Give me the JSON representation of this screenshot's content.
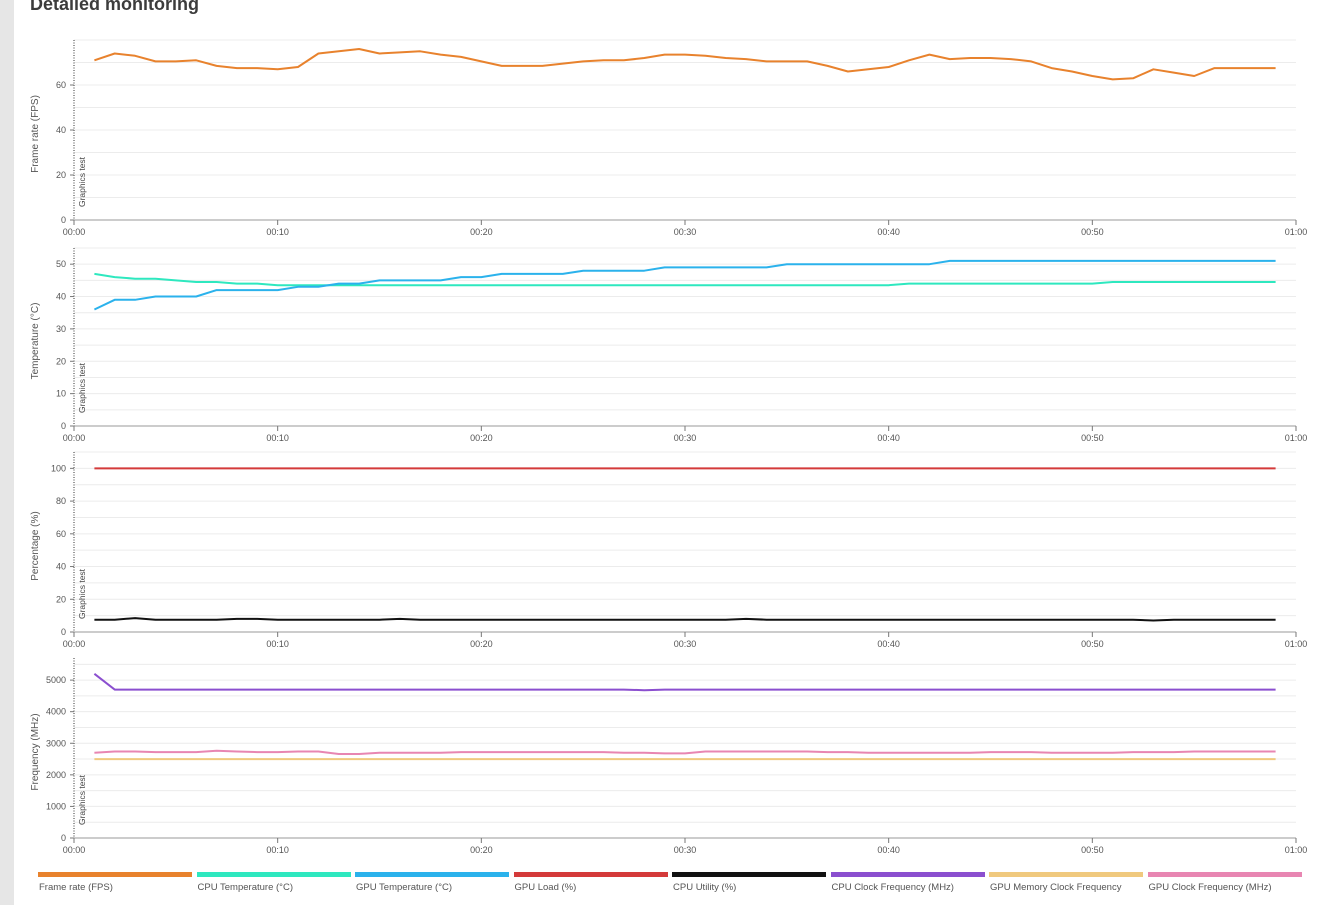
{
  "page": {
    "title": "Detailed monitoring"
  },
  "marker_label": "Graphics test",
  "legend": [
    {
      "label": "Frame rate (FPS)",
      "color": "#e8822d"
    },
    {
      "label": "CPU Temperature (°C)",
      "color": "#2ee8bf"
    },
    {
      "label": "GPU Temperature (°C)",
      "color": "#2bb2ec"
    },
    {
      "label": "GPU Load (%)",
      "color": "#d43a3a"
    },
    {
      "label": "CPU Utility (%)",
      "color": "#111111"
    },
    {
      "label": "CPU Clock Frequency (MHz)",
      "color": "#8b4fcf"
    },
    {
      "label": "GPU Memory Clock Frequency",
      "color": "#f0c97e"
    },
    {
      "label": "GPU Clock Frequency (MHz)",
      "color": "#e886b2"
    }
  ],
  "chart_data": [
    {
      "type": "line",
      "ylabel": "Frame rate (FPS)",
      "ylim": [
        0,
        80
      ],
      "yticks": [
        0,
        20,
        40,
        60
      ],
      "xlim": [
        0,
        60
      ],
      "xticks": [
        "00:00",
        "00:10",
        "00:20",
        "00:30",
        "00:40",
        "00:50",
        "01:00"
      ],
      "grid": true,
      "series": [
        {
          "name": "Frame rate (FPS)",
          "color": "#e8822d",
          "x": [
            1,
            2,
            3,
            4,
            5,
            6,
            7,
            8,
            9,
            10,
            11,
            12,
            13,
            14,
            15,
            16,
            17,
            18,
            19,
            20,
            21,
            22,
            23,
            24,
            25,
            26,
            27,
            28,
            29,
            30,
            31,
            32,
            33,
            34,
            35,
            36,
            37,
            38,
            39,
            40,
            41,
            42,
            43,
            44,
            45,
            46,
            47,
            48,
            49,
            50,
            51,
            52,
            53,
            54,
            55,
            56,
            57,
            58,
            59
          ],
          "y": [
            71,
            74,
            73,
            70.5,
            70.5,
            71,
            68.5,
            67.5,
            67.5,
            67,
            68,
            74,
            75,
            76,
            74,
            74.5,
            75,
            73.5,
            72.5,
            70.5,
            68.5,
            68.5,
            68.5,
            69.5,
            70.5,
            71,
            71,
            72,
            73.5,
            73.5,
            73,
            72,
            71.5,
            70.5,
            70.5,
            70.5,
            68.5,
            66,
            67,
            68,
            71,
            73.5,
            71.5,
            72,
            72,
            71.5,
            70.5,
            67.5,
            66,
            64,
            62.5,
            63,
            67,
            65.5,
            64,
            67.5,
            67.5,
            67.5,
            67.5
          ]
        }
      ]
    },
    {
      "type": "line",
      "ylabel": "Temperature (°C)",
      "ylim": [
        0,
        55
      ],
      "yticks": [
        0,
        10,
        20,
        30,
        40,
        50
      ],
      "xlim": [
        0,
        60
      ],
      "xticks": [
        "00:00",
        "00:10",
        "00:20",
        "00:30",
        "00:40",
        "00:50",
        "01:00"
      ],
      "grid": true,
      "series": [
        {
          "name": "CPU Temperature (°C)",
          "color": "#2ee8bf",
          "x": [
            1,
            2,
            3,
            4,
            5,
            6,
            7,
            8,
            9,
            10,
            11,
            12,
            13,
            14,
            15,
            16,
            17,
            18,
            19,
            20,
            21,
            22,
            23,
            24,
            25,
            26,
            27,
            28,
            29,
            30,
            31,
            32,
            33,
            34,
            35,
            36,
            37,
            38,
            39,
            40,
            41,
            42,
            43,
            44,
            45,
            46,
            47,
            48,
            49,
            50,
            51,
            52,
            53,
            54,
            55,
            56,
            57,
            58,
            59
          ],
          "y": [
            47,
            46,
            45.5,
            45.5,
            45,
            44.5,
            44.5,
            44,
            44,
            43.5,
            43.5,
            43.5,
            43.5,
            43.5,
            43.5,
            43.5,
            43.5,
            43.5,
            43.5,
            43.5,
            43.5,
            43.5,
            43.5,
            43.5,
            43.5,
            43.5,
            43.5,
            43.5,
            43.5,
            43.5,
            43.5,
            43.5,
            43.5,
            43.5,
            43.5,
            43.5,
            43.5,
            43.5,
            43.5,
            43.5,
            44,
            44,
            44,
            44,
            44,
            44,
            44,
            44,
            44,
            44,
            44.5,
            44.5,
            44.5,
            44.5,
            44.5,
            44.5,
            44.5,
            44.5,
            44.5
          ]
        },
        {
          "name": "GPU Temperature (°C)",
          "color": "#2bb2ec",
          "x": [
            1,
            2,
            3,
            4,
            5,
            6,
            7,
            8,
            9,
            10,
            11,
            12,
            13,
            14,
            15,
            16,
            17,
            18,
            19,
            20,
            21,
            22,
            23,
            24,
            25,
            26,
            27,
            28,
            29,
            30,
            31,
            32,
            33,
            34,
            35,
            36,
            37,
            38,
            39,
            40,
            41,
            42,
            43,
            44,
            45,
            46,
            47,
            48,
            49,
            50,
            51,
            52,
            53,
            54,
            55,
            56,
            57,
            58,
            59
          ],
          "y": [
            36,
            39,
            39,
            40,
            40,
            40,
            42,
            42,
            42,
            42,
            43,
            43,
            44,
            44,
            45,
            45,
            45,
            45,
            46,
            46,
            47,
            47,
            47,
            47,
            48,
            48,
            48,
            48,
            49,
            49,
            49,
            49,
            49,
            49,
            50,
            50,
            50,
            50,
            50,
            50,
            50,
            50,
            51,
            51,
            51,
            51,
            51,
            51,
            51,
            51,
            51,
            51,
            51,
            51,
            51,
            51,
            51,
            51,
            51
          ]
        }
      ]
    },
    {
      "type": "line",
      "ylabel": "Percentage (%)",
      "ylim": [
        0,
        110
      ],
      "yticks": [
        0,
        20,
        40,
        60,
        80,
        100
      ],
      "xlim": [
        0,
        60
      ],
      "xticks": [
        "00:00",
        "00:10",
        "00:20",
        "00:30",
        "00:40",
        "00:50",
        "01:00"
      ],
      "grid": true,
      "series": [
        {
          "name": "GPU Load (%)",
          "color": "#d43a3a",
          "x": [
            1,
            59
          ],
          "y": [
            100,
            100
          ]
        },
        {
          "name": "CPU Utility (%)",
          "color": "#111111",
          "x": [
            1,
            2,
            3,
            4,
            5,
            6,
            7,
            8,
            9,
            10,
            11,
            12,
            13,
            14,
            15,
            16,
            17,
            18,
            19,
            20,
            21,
            22,
            23,
            24,
            25,
            26,
            27,
            28,
            29,
            30,
            31,
            32,
            33,
            34,
            35,
            36,
            37,
            38,
            39,
            40,
            41,
            42,
            43,
            44,
            45,
            46,
            47,
            48,
            49,
            50,
            51,
            52,
            53,
            54,
            55,
            56,
            57,
            58,
            59
          ],
          "y": [
            7.5,
            7.5,
            8.5,
            7.5,
            7.5,
            7.5,
            7.5,
            8,
            8,
            7.5,
            7.5,
            7.5,
            7.5,
            7.5,
            7.5,
            8,
            7.5,
            7.5,
            7.5,
            7.5,
            7.5,
            7.5,
            7.5,
            7.5,
            7.5,
            7.5,
            7.5,
            7.5,
            7.5,
            7.5,
            7.5,
            7.5,
            8,
            7.5,
            7.5,
            7.5,
            7.5,
            7.5,
            7.5,
            7.5,
            7.5,
            7.5,
            7.5,
            7.5,
            7.5,
            7.5,
            7.5,
            7.5,
            7.5,
            7.5,
            7.5,
            7.5,
            7,
            7.5,
            7.5,
            7.5,
            7.5,
            7.5,
            7.5
          ]
        }
      ]
    },
    {
      "type": "line",
      "ylabel": "Frequency (MHz)",
      "ylim": [
        0,
        5700
      ],
      "yticks": [
        0,
        1000,
        2000,
        3000,
        4000,
        5000
      ],
      "xlim": [
        0,
        60
      ],
      "xticks": [
        "00:00",
        "00:10",
        "00:20",
        "00:30",
        "00:40",
        "00:50",
        "01:00"
      ],
      "grid": true,
      "series": [
        {
          "name": "CPU Clock Frequency (MHz)",
          "color": "#8b4fcf",
          "x": [
            1,
            2,
            3,
            4,
            5,
            6,
            7,
            8,
            9,
            10,
            11,
            12,
            13,
            14,
            15,
            16,
            17,
            18,
            19,
            20,
            21,
            22,
            23,
            24,
            25,
            26,
            27,
            28,
            29,
            30,
            31,
            32,
            33,
            34,
            35,
            36,
            37,
            38,
            39,
            40,
            41,
            42,
            43,
            44,
            45,
            46,
            47,
            48,
            49,
            50,
            51,
            52,
            53,
            54,
            55,
            56,
            57,
            58,
            59
          ],
          "y": [
            5200,
            4700,
            4700,
            4700,
            4700,
            4700,
            4700,
            4700,
            4700,
            4700,
            4700,
            4700,
            4700,
            4700,
            4700,
            4700,
            4700,
            4700,
            4700,
            4700,
            4700,
            4700,
            4700,
            4700,
            4700,
            4700,
            4700,
            4680,
            4700,
            4700,
            4700,
            4700,
            4700,
            4700,
            4700,
            4700,
            4700,
            4700,
            4700,
            4700,
            4700,
            4700,
            4700,
            4700,
            4700,
            4700,
            4700,
            4700,
            4700,
            4700,
            4700,
            4700,
            4700,
            4700,
            4700,
            4700,
            4700,
            4700,
            4700
          ]
        },
        {
          "name": "GPU Memory Clock Frequency",
          "color": "#f0c97e",
          "x": [
            1,
            59
          ],
          "y": [
            2500,
            2500
          ]
        },
        {
          "name": "GPU Clock Frequency (MHz)",
          "color": "#e886b2",
          "x": [
            1,
            2,
            3,
            4,
            5,
            6,
            7,
            8,
            9,
            10,
            11,
            12,
            13,
            14,
            15,
            16,
            17,
            18,
            19,
            20,
            21,
            22,
            23,
            24,
            25,
            26,
            27,
            28,
            29,
            30,
            31,
            32,
            33,
            34,
            35,
            36,
            37,
            38,
            39,
            40,
            41,
            42,
            43,
            44,
            45,
            46,
            47,
            48,
            49,
            50,
            51,
            52,
            53,
            54,
            55,
            56,
            57,
            58,
            59
          ],
          "y": [
            2700,
            2740,
            2740,
            2720,
            2720,
            2720,
            2760,
            2740,
            2720,
            2720,
            2740,
            2740,
            2660,
            2660,
            2700,
            2700,
            2700,
            2700,
            2720,
            2720,
            2720,
            2720,
            2720,
            2720,
            2720,
            2720,
            2700,
            2700,
            2680,
            2680,
            2740,
            2740,
            2740,
            2740,
            2740,
            2740,
            2720,
            2720,
            2700,
            2700,
            2700,
            2700,
            2700,
            2700,
            2720,
            2720,
            2720,
            2700,
            2700,
            2700,
            2700,
            2720,
            2720,
            2720,
            2740,
            2740,
            2740,
            2740,
            2740
          ]
        }
      ]
    }
  ]
}
